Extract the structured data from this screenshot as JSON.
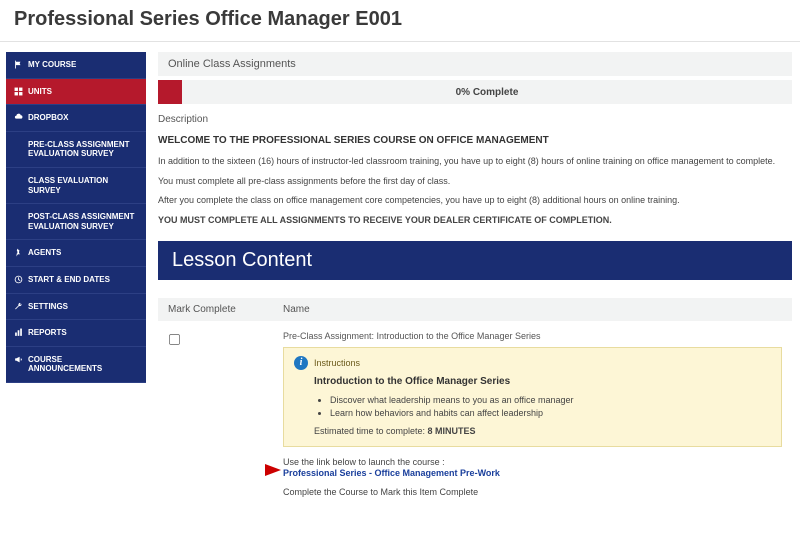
{
  "pageTitle": "Professional Series Office Manager E001",
  "sidebar": {
    "items": [
      {
        "label": "MY COURSE"
      },
      {
        "label": "UNITS"
      },
      {
        "label": "DROPBOX"
      },
      {
        "label": "PRE-CLASS ASSIGNMENT EVALUATION SURVEY"
      },
      {
        "label": "CLASS EVALUATION SURVEY"
      },
      {
        "label": "POST-CLASS ASSIGNMENT EVALUATION SURVEY"
      },
      {
        "label": "AGENTS"
      },
      {
        "label": "START & END DATES"
      },
      {
        "label": "SETTINGS"
      },
      {
        "label": "REPORTS"
      },
      {
        "label": "COURSE ANNOUNCEMENTS"
      }
    ]
  },
  "main": {
    "sectionTitle": "Online Class Assignments",
    "progressText": "0% Complete",
    "descLabel": "Description",
    "welcome": "WELCOME TO THE PROFESSIONAL SERIES COURSE ON OFFICE MANAGEMENT",
    "p1": "In addition to the sixteen (16) hours of instructor-led classroom training, you have up to eight (8) hours of online training on office management to complete.",
    "p2": "You must complete all pre-class assignments before the first day of class.",
    "p3": "After you complete the class on office management core competencies, you have up to eight (8) additional hours on online training.",
    "p4": "YOU MUST COMPLETE ALL ASSIGNMENTS TO RECEIVE YOUR DEALER CERTIFICATE OF COMPLETION.",
    "lessonHeader": "Lesson Content",
    "colMark": "Mark Complete",
    "colName": "Name",
    "assignTitle": "Pre-Class Assignment: Introduction to the Office Manager Series",
    "instLabel": "Instructions",
    "instTitle": "Introduction to the Office Manager Series",
    "bullets": [
      "Discover what leadership means to you as an office manager",
      "Learn how behaviors and habits can affect leadership"
    ],
    "estPrefix": "Estimated time to complete: ",
    "estValue": "8 MINUTES",
    "launchIntro": "Use the link below to launch the course :",
    "launchLink": "Professional Series - Office Management Pre-Work",
    "completePrompt": "Complete the Course to Mark this Item Complete"
  }
}
